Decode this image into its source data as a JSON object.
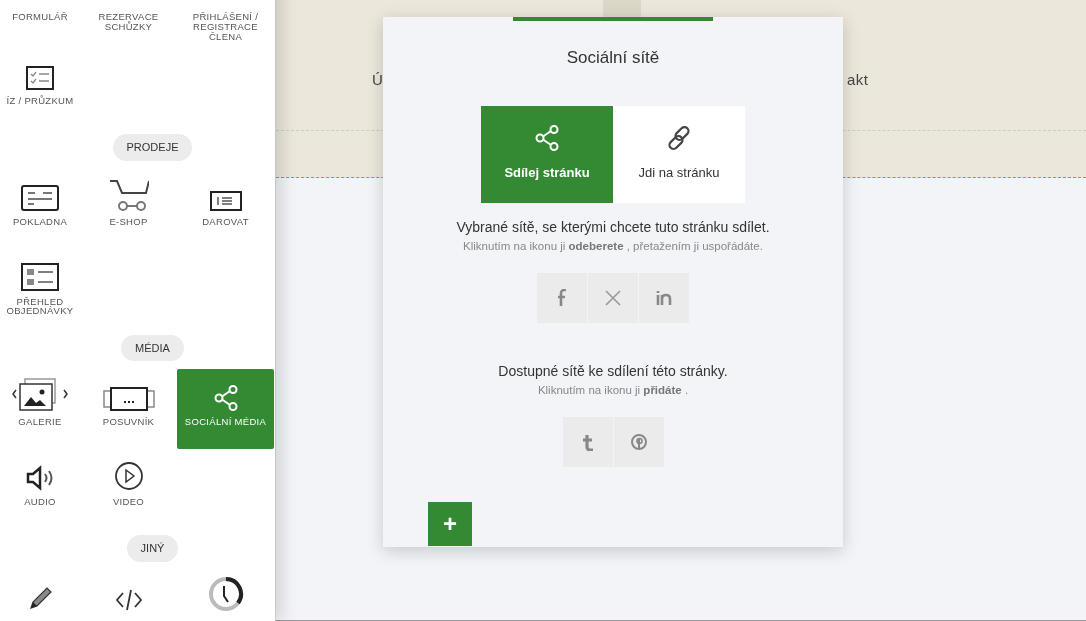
{
  "sidebar": {
    "sections": [
      {
        "items": [
          {
            "label": "FORMULÁŘ",
            "selected": false
          },
          {
            "label": "REZERVACE SCHŮZKY",
            "selected": false
          },
          {
            "label": "PŘIHLÁŠENÍ / REGISTRACE ČLENA",
            "selected": false
          },
          {
            "label": "ÍZ / PRŮZKUM",
            "selected": false
          }
        ]
      },
      {
        "heading": "PRODEJE",
        "items": [
          {
            "label": "POKLADNA",
            "selected": false
          },
          {
            "label": "E-SHOP",
            "selected": false
          },
          {
            "label": "DAROVAT",
            "selected": false
          },
          {
            "label": "PŘEHLED OBJEDNÁVKY",
            "selected": false
          }
        ]
      },
      {
        "heading": "MÉDIA",
        "items": [
          {
            "label": "GALERIE",
            "selected": false
          },
          {
            "label": "POSUVNÍK",
            "selected": false
          },
          {
            "label": "SOCIÁLNÍ MÉDIA",
            "selected": true
          },
          {
            "label": "AUDIO",
            "selected": false
          },
          {
            "label": "VIDEO",
            "selected": false
          }
        ]
      },
      {
        "heading": "JINÝ",
        "items": [
          {
            "selected": false
          },
          {
            "selected": false
          },
          {
            "selected": false
          }
        ]
      }
    ]
  },
  "site_header": {
    "nav_left": "Ú",
    "nav_right": "akt"
  },
  "dialog": {
    "title": "Sociální sítě",
    "tabs": [
      {
        "label": "Sdílej stránku",
        "selected": true
      },
      {
        "label": "Jdi na stránku",
        "selected": false
      }
    ],
    "selected_networks": {
      "heading": "Vybrané sítě, se kterými chcete tuto stránku sdílet.",
      "hint": "Kliknutím na ikonu ji **odeberete** , přetažením ji uspořádáte."
    },
    "available_networks": {
      "heading": "Dostupné sítě ke sdílení této stránky.",
      "hint": "Kliknutím na ikonu ji **přidáte** ."
    },
    "add_button": "+"
  }
}
